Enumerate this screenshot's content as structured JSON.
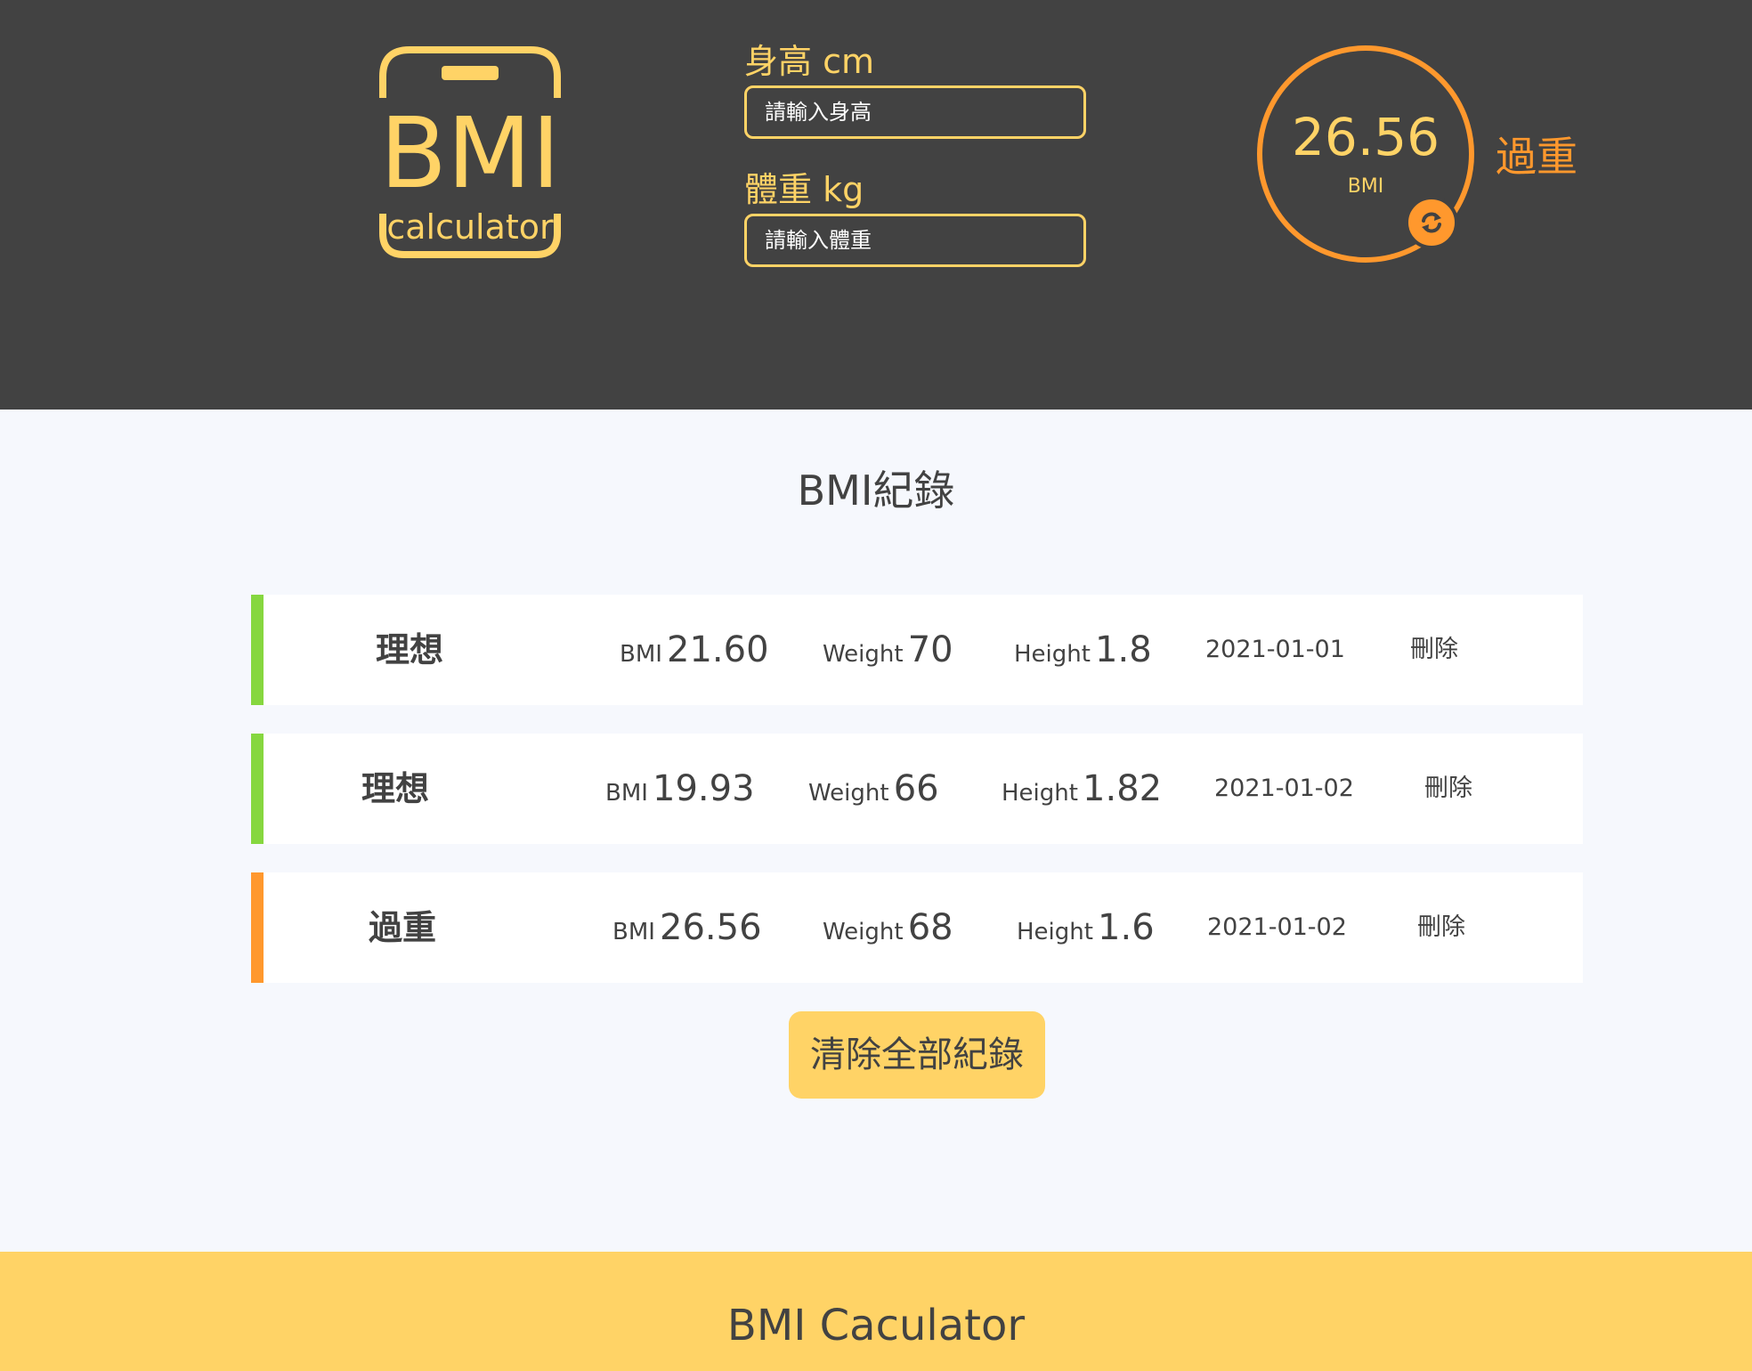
{
  "logo": {
    "main_text": "BMI",
    "sub_text": "calculator"
  },
  "form": {
    "height_label": "身高 cm",
    "height_placeholder": "請輸入身高",
    "weight_label": "體重 kg",
    "weight_placeholder": "請輸入體重"
  },
  "result": {
    "bmi_value": "26.56",
    "unit": "BMI",
    "status": "過重",
    "refresh_icon": "refresh-icon"
  },
  "records_title": "BMI紀錄",
  "records": [
    {
      "status": "理想",
      "bmi_label": "BMI",
      "bmi": "21.60",
      "weight_label": "Weight",
      "weight": "70",
      "height_label": "Height",
      "height": "1.8",
      "date": "2021-01-01",
      "delete_label": "刪除",
      "color": "#86D73F"
    },
    {
      "status": "理想",
      "bmi_label": "BMI",
      "bmi": "19.93",
      "weight_label": "Weight",
      "weight": "66",
      "height_label": "Height",
      "height": "1.82",
      "date": "2021-01-02",
      "delete_label": "刪除",
      "color": "#86D73F"
    },
    {
      "status": "過重",
      "bmi_label": "BMI",
      "bmi": "26.56",
      "weight_label": "Weight",
      "weight": "68",
      "height_label": "Height",
      "height": "1.6",
      "date": "2021-01-02",
      "delete_label": "刪除",
      "color": "#FF982D"
    }
  ],
  "clear_button": "清除全部紀錄",
  "footer_title": "BMI Caculator",
  "colors": {
    "dark": "#424242",
    "yellow": "#FFD366",
    "orange": "#FF982D",
    "green": "#86D73F",
    "background": "#F6F8FD"
  }
}
